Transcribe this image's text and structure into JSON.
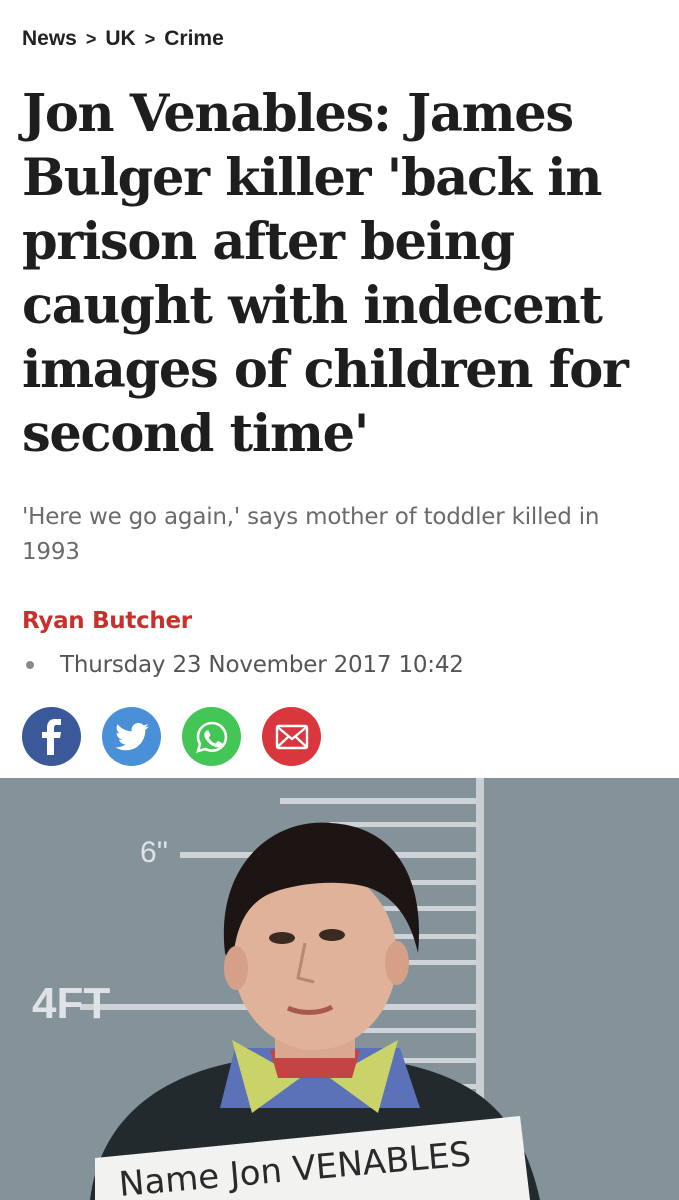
{
  "breadcrumb": {
    "items": [
      "News",
      "UK",
      "Crime"
    ],
    "separator": ">"
  },
  "article": {
    "headline": "Jon Venables: James Bulger killer 'back in prison after being caught with indecent images of children for second time'",
    "standfirst": "'Here we go again,' says mother of toddler killed in 1993",
    "author": "Ryan Butcher",
    "date": "Thursday 23 November 2017 10:42"
  },
  "share": {
    "buttons": [
      {
        "icon": "facebook-icon",
        "color": "#3b5998"
      },
      {
        "icon": "twitter-icon",
        "color": "#4a90d9"
      },
      {
        "icon": "whatsapp-icon",
        "color": "#43c655"
      },
      {
        "icon": "email-icon",
        "color": "#d9363e"
      }
    ]
  },
  "photo": {
    "height_marks": [
      "6''",
      "4FT"
    ],
    "placard_text": "Name  Jon VENABLES"
  },
  "colors": {
    "author": "#c9302c",
    "headline": "#1e1e1e",
    "standfirst": "#6a6a6a"
  }
}
